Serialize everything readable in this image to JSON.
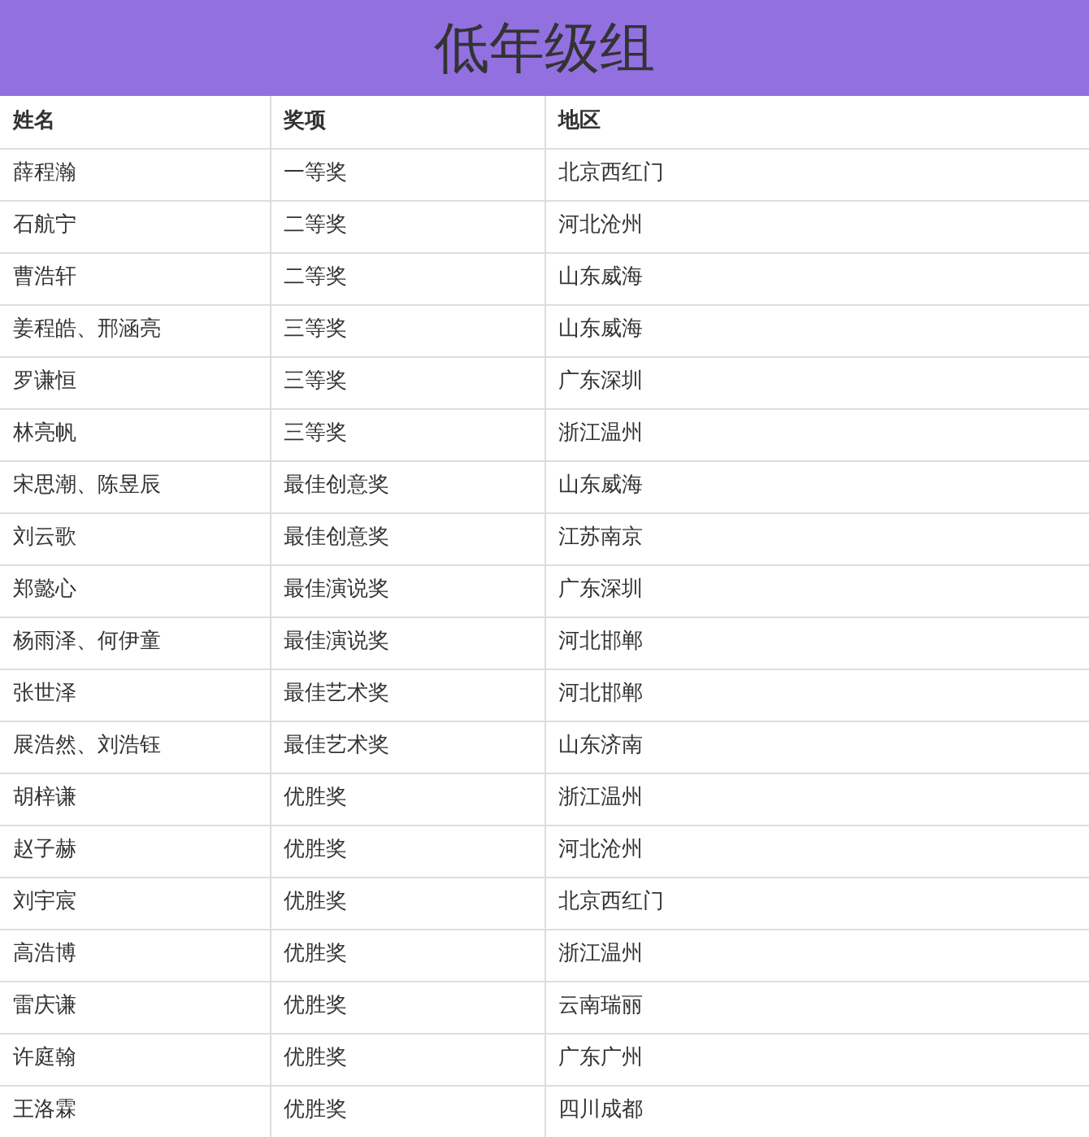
{
  "title": "低年级组",
  "table": {
    "columns": [
      "姓名",
      "奖项",
      "地区"
    ],
    "rows": [
      [
        "薛程瀚",
        "一等奖",
        "北京西红门"
      ],
      [
        "石航宁",
        "二等奖",
        "河北沧州"
      ],
      [
        "曹浩轩",
        "二等奖",
        "山东威海"
      ],
      [
        "姜程皓、邢涵亮",
        "三等奖",
        "山东威海"
      ],
      [
        "罗谦恒",
        "三等奖",
        "广东深圳"
      ],
      [
        "林亮帆",
        "三等奖",
        "浙江温州"
      ],
      [
        "宋思潮、陈昱辰",
        "最佳创意奖",
        "山东威海"
      ],
      [
        "刘云歌",
        "最佳创意奖",
        "江苏南京"
      ],
      [
        "郑懿心",
        "最佳演说奖",
        "广东深圳"
      ],
      [
        "杨雨泽、何伊童",
        "最佳演说奖",
        "河北邯郸"
      ],
      [
        "张世泽",
        "最佳艺术奖",
        "河北邯郸"
      ],
      [
        "展浩然、刘浩钰",
        "最佳艺术奖",
        "山东济南"
      ],
      [
        "胡梓谦",
        "优胜奖",
        "浙江温州"
      ],
      [
        "赵子赫",
        "优胜奖",
        "河北沧州"
      ],
      [
        "刘宇宸",
        "优胜奖",
        "北京西红门"
      ],
      [
        "高浩博",
        "优胜奖",
        "浙江温州"
      ],
      [
        "雷庆谦",
        "优胜奖",
        "云南瑞丽"
      ],
      [
        "许庭翰",
        "优胜奖",
        "广东广州"
      ],
      [
        "王洛霖",
        "优胜奖",
        "四川成都"
      ]
    ]
  }
}
